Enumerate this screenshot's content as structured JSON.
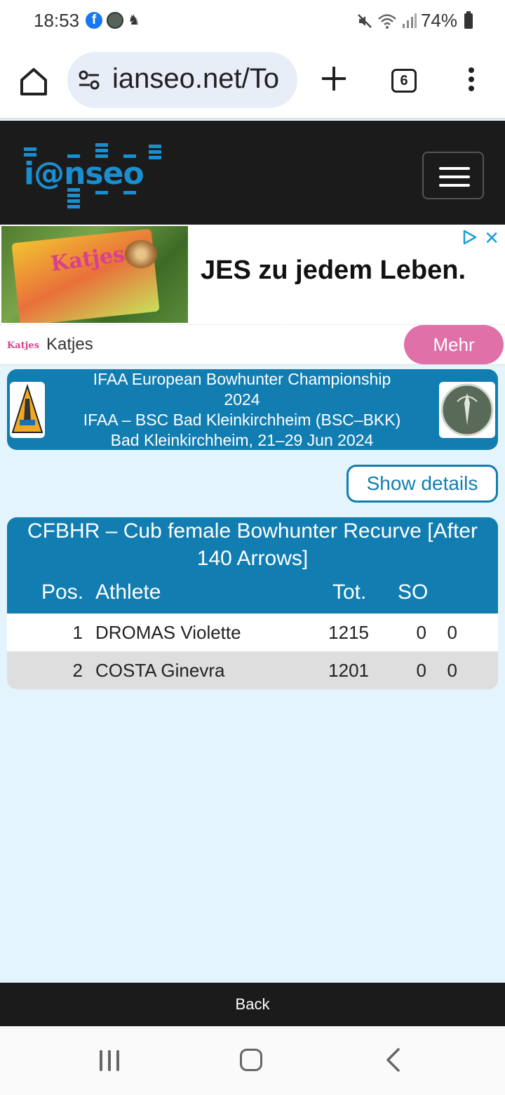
{
  "status_bar": {
    "time": "18:53",
    "battery": "74%",
    "icons": [
      "facebook-icon",
      "app-icon",
      "accessibility-icon",
      "mute-icon",
      "wifi-icon",
      "signal-icon",
      "battery-icon"
    ]
  },
  "browser": {
    "url": "ianseo.net/To",
    "tab_count": "6"
  },
  "ad": {
    "headline": "JES zu jedem Leben.",
    "advertiser": "Katjes",
    "logo_text": "Katjes",
    "pack_text": "Katjes",
    "cta": "Mehr"
  },
  "event": {
    "line1": "IFAA European Bowhunter Championship",
    "line2": "2024",
    "line3": "IFAA – BSC Bad Kleinkirchheim (BSC–BKK)",
    "line4": "Bad Kleinkirchheim, 21–29 Jun 2024"
  },
  "show_details": "Show details",
  "results": {
    "title": "CFBHR – Cub female Bowhunter Recurve [After 140 Arrows]",
    "columns": {
      "pos": "Pos.",
      "athlete": "Athlete",
      "tot": "Tot.",
      "so": "SO"
    },
    "rows": [
      {
        "pos": "1",
        "athlete": "DROMAS Violette",
        "tot": "1215",
        "so1": "0",
        "so2": "0"
      },
      {
        "pos": "2",
        "athlete": "COSTA Ginevra",
        "tot": "1201",
        "so1": "0",
        "so2": "0"
      }
    ]
  },
  "back": "Back",
  "colors": {
    "accent": "#117db1",
    "page_bg": "#e4f4fc",
    "header_bg": "#1b1b1b",
    "cta": "#e070a8"
  }
}
